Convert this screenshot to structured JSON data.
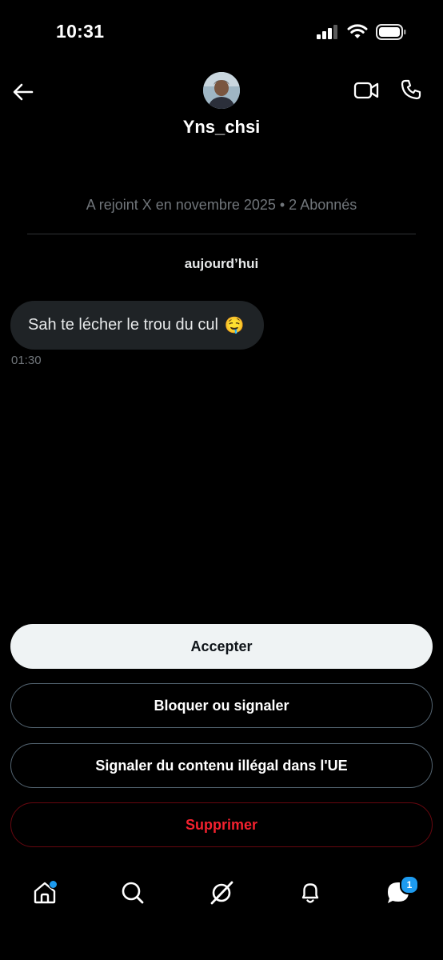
{
  "status_bar": {
    "time": "10:31"
  },
  "header": {
    "username": "Yns_chsi"
  },
  "conversation": {
    "joined_info": "A rejoint X en novembre 2025 • 2 Abonnés",
    "day_label": "aujourd’hui",
    "messages": [
      {
        "text": "Sah te lécher le trou du cul",
        "emoji": "🤤",
        "time": "01:30"
      }
    ]
  },
  "actions": {
    "accept": "Accepter",
    "block_report": "Bloquer ou signaler",
    "report_illegal": "Signaler du contenu illégal dans l'UE",
    "delete": "Supprimer"
  },
  "tabbar": {
    "items": [
      {
        "icon": "home-icon",
        "notification_dot": true
      },
      {
        "icon": "search-icon"
      },
      {
        "icon": "grok-icon"
      },
      {
        "icon": "bell-icon"
      },
      {
        "icon": "messages-icon",
        "badge": "1"
      }
    ]
  },
  "colors": {
    "background": "#000000",
    "accent": "#1d9bf0",
    "danger": "#f4212e",
    "bubble": "#1f2326"
  }
}
